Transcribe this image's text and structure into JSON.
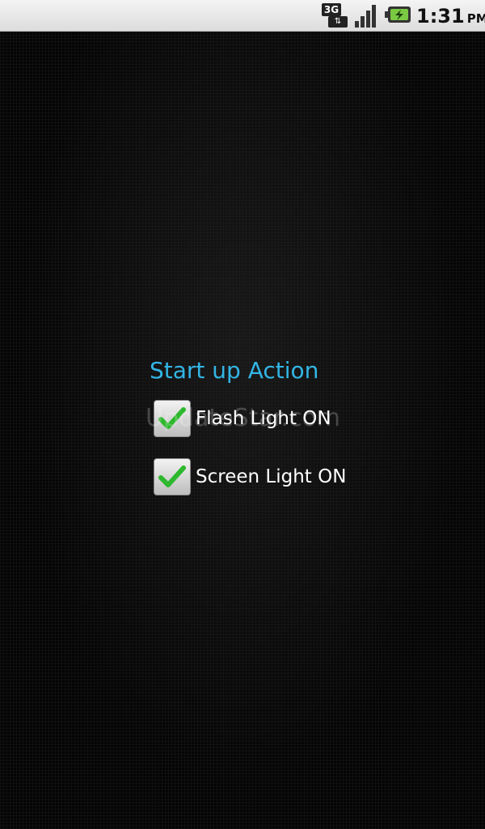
{
  "status_bar": {
    "network_label": "3G",
    "time": "1:31",
    "ampm": "PM",
    "icons": [
      "3g-data-icon",
      "signal-icon",
      "battery-charging-icon"
    ]
  },
  "dialog": {
    "title": "Start up Action",
    "options": [
      {
        "label": "Flash Light ON",
        "checked": true
      },
      {
        "label": "Screen Light ON",
        "checked": true
      }
    ]
  },
  "watermark": "UpdateStar.com",
  "colors": {
    "title": "#33b5e5",
    "check": "#2db82d",
    "background": "#000000"
  }
}
